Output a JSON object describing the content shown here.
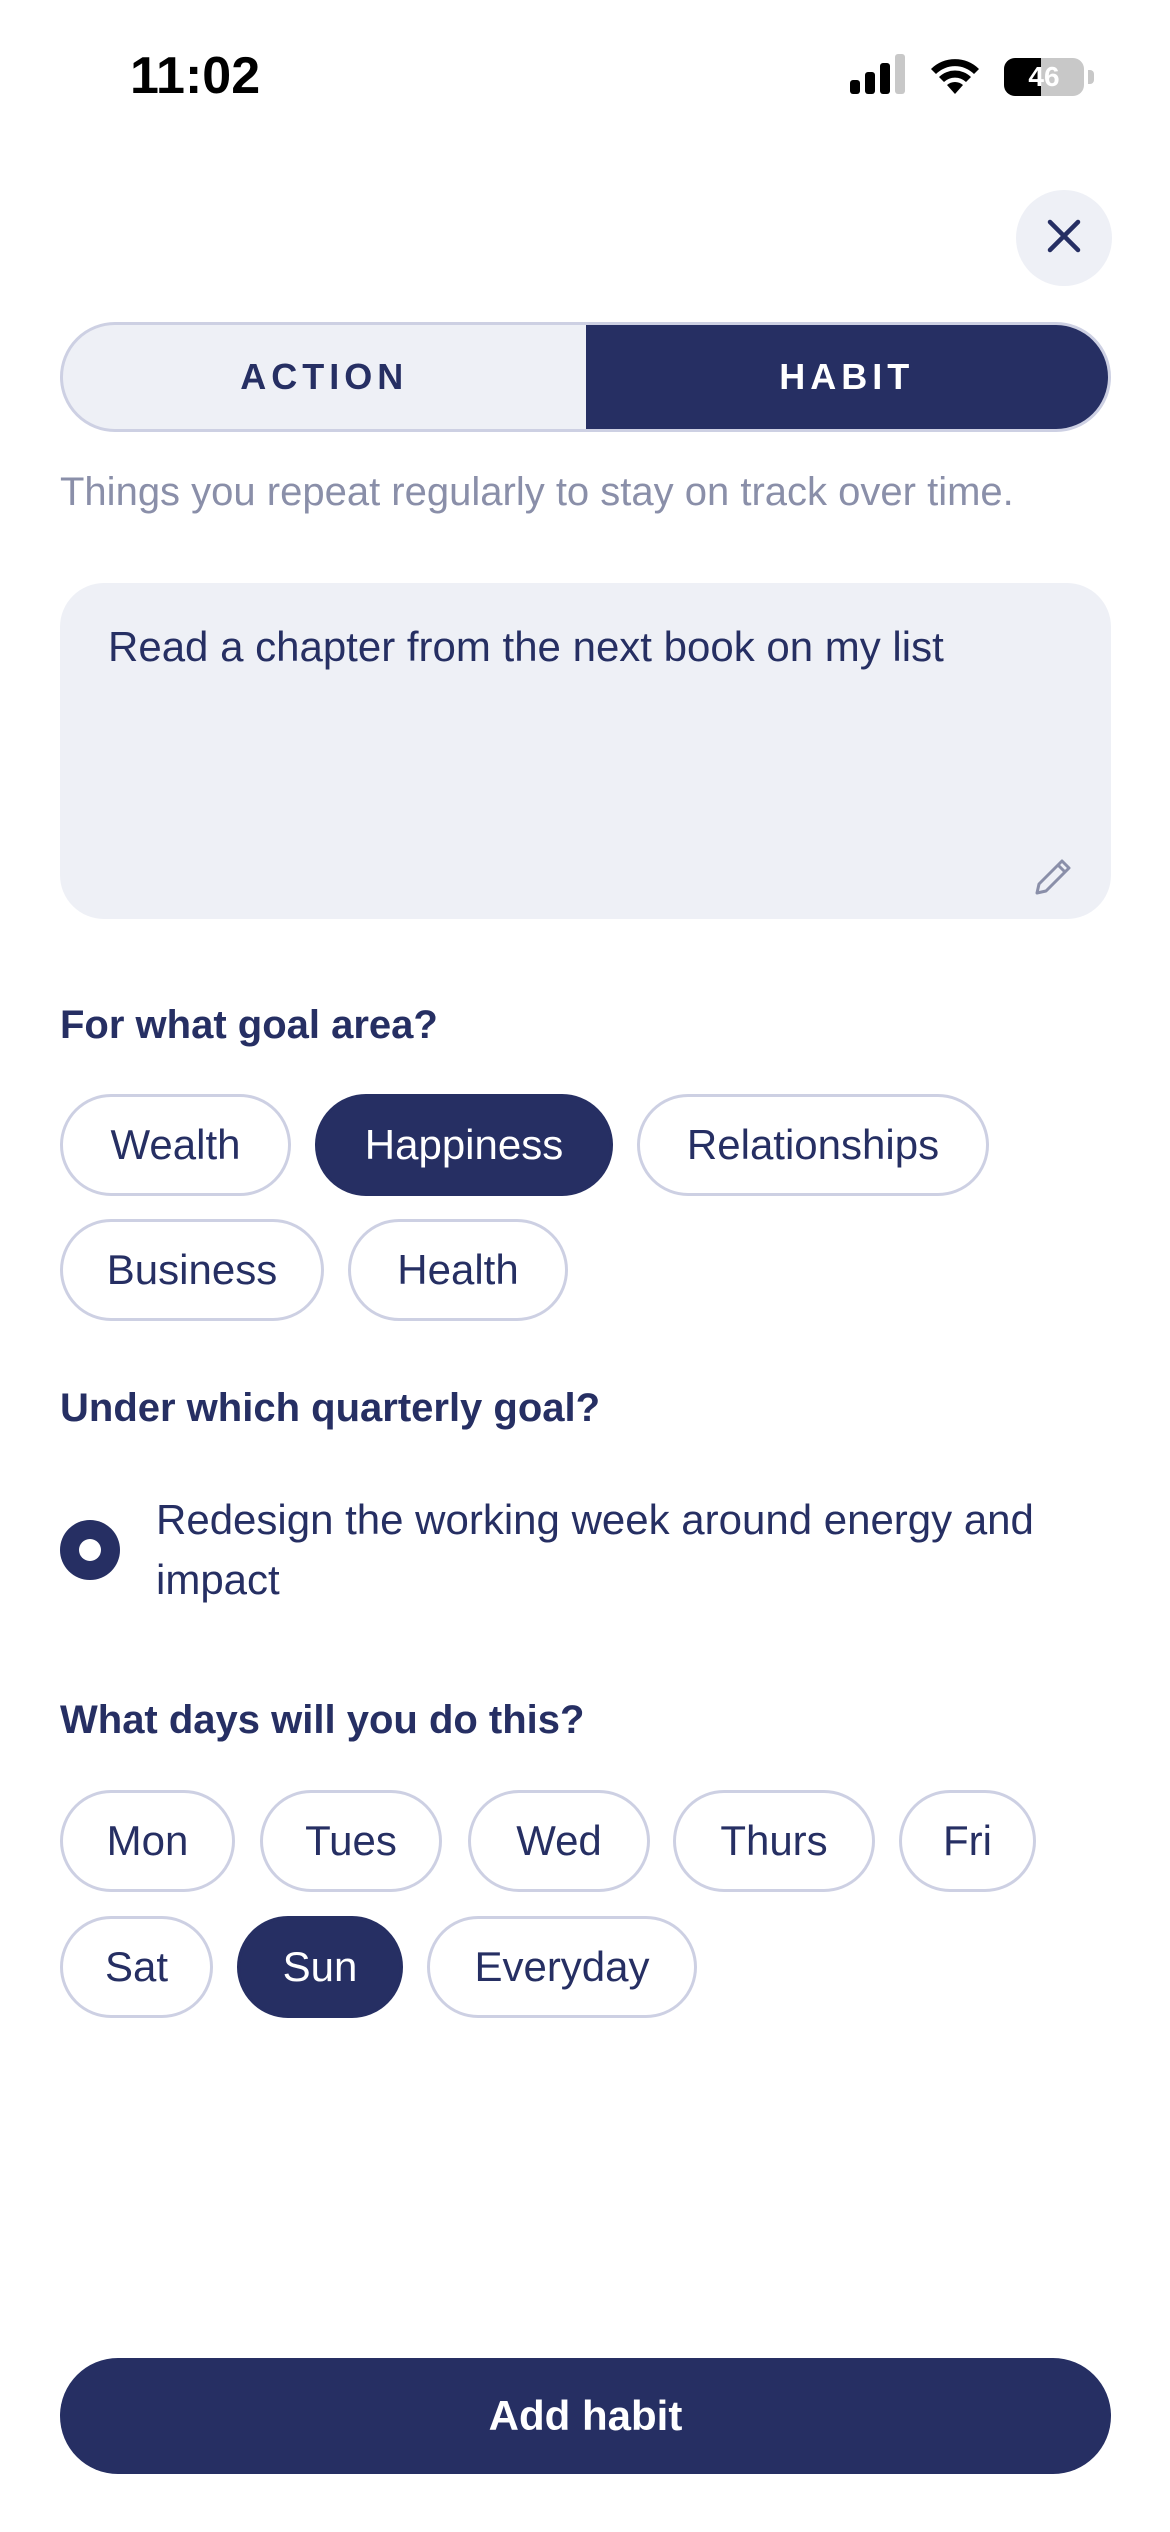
{
  "status_bar": {
    "time": "11:02",
    "battery": "46",
    "battery_level": 0.46,
    "icons": [
      "cellular-signal-icon",
      "wifi-icon",
      "battery-icon"
    ]
  },
  "close_icon": "close-icon",
  "mode_toggle": {
    "options": [
      "ACTION",
      "HABIT"
    ],
    "selected": "HABIT"
  },
  "description": "Things you repeat regularly to stay on track over time.",
  "habit_text": "Read a chapter from the next book on my list",
  "edit_icon": "pencil-icon",
  "goal_area": {
    "label": "For what goal area?",
    "options": [
      "Wealth",
      "Happiness",
      "Relationships",
      "Business",
      "Health"
    ],
    "selected": "Happiness"
  },
  "quarterly_goal": {
    "label": "Under which quarterly goal?",
    "option": "Redesign the working week around energy and impact",
    "selected": true
  },
  "days": {
    "label": "What days will you do this?",
    "options": [
      "Mon",
      "Tues",
      "Wed",
      "Thurs",
      "Fri",
      "Sat",
      "Sun",
      "Everyday"
    ],
    "selected": "Sun"
  },
  "submit_label": "Add habit",
  "colors": {
    "primary": "#262f63",
    "surface": "#eef0f6",
    "border": "#cdd0e3",
    "muted_text": "#8a8fa9"
  }
}
